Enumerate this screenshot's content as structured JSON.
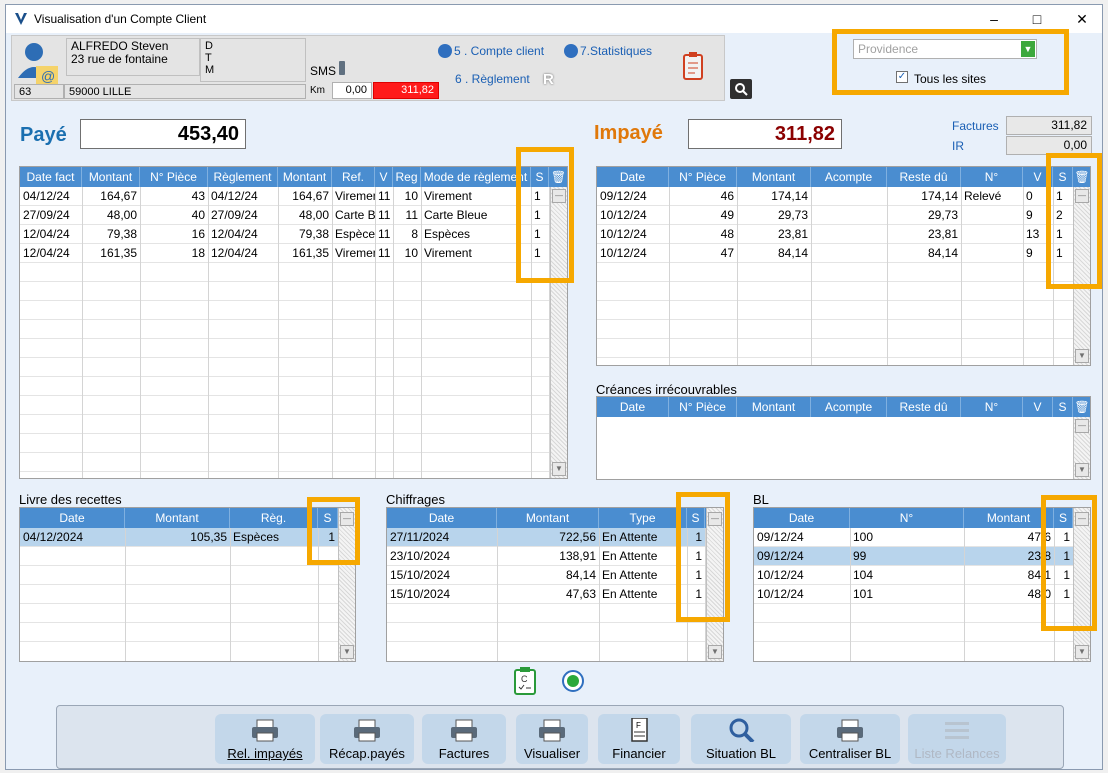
{
  "window": {
    "title": "Visualisation d'un Compte Client"
  },
  "client": {
    "name": "ALFREDO Steven",
    "address": "23 rue de fontaine",
    "flags": [
      "D",
      "T",
      "M"
    ],
    "code": "63",
    "city": "59000 LILLE",
    "sms": "SMS",
    "km_label": "Km",
    "km": "0,00",
    "balance": "311,82"
  },
  "links": {
    "compte": "5 . Compte client",
    "stats": "7.Statistiques",
    "reglement": "6 . Règlement",
    "r": "R"
  },
  "site": {
    "selected": "Providence",
    "all_sites": "Tous les sites"
  },
  "paye": {
    "label": "Payé",
    "value": "453,40"
  },
  "impaye": {
    "label": "Impayé",
    "value": "311,82"
  },
  "totals": {
    "factures_label": "Factures",
    "factures": "311,82",
    "ir_label": "IR",
    "ir": "0,00"
  },
  "paid": {
    "headers": [
      "Date fact",
      "Montant",
      "N° Pièce",
      "Règlement",
      "Montant",
      "Ref.",
      "V",
      "Reg",
      "Mode de règlement",
      "S"
    ],
    "rows": [
      [
        "04/12/24",
        "164,67",
        "43",
        "04/12/24",
        "164,67",
        "Virement",
        "11",
        "10",
        "Virement",
        "1"
      ],
      [
        "27/09/24",
        "48,00",
        "40",
        "27/09/24",
        "48,00",
        "Carte Bleue",
        "11",
        "11",
        "Carte Bleue",
        "1"
      ],
      [
        "12/04/24",
        "79,38",
        "16",
        "12/04/24",
        "79,38",
        "Espèces",
        "11",
        "8",
        "Espèces",
        "1"
      ],
      [
        "12/04/24",
        "161,35",
        "18",
        "12/04/24",
        "161,35",
        "Virement",
        "11",
        "10",
        "Virement",
        "1"
      ]
    ]
  },
  "unpaid": {
    "headers": [
      "Date",
      "N° Pièce",
      "Montant",
      "Acompte",
      "Reste dû",
      "N°",
      "V",
      "S"
    ],
    "rows": [
      [
        "09/12/24",
        "46",
        "174,14",
        "",
        "174,14",
        "Relevé",
        "0",
        "1"
      ],
      [
        "10/12/24",
        "49",
        "29,73",
        "",
        "29,73",
        "",
        "9",
        "2"
      ],
      [
        "10/12/24",
        "48",
        "23,81",
        "",
        "23,81",
        "",
        "13",
        "1"
      ],
      [
        "10/12/24",
        "47",
        "84,14",
        "",
        "84,14",
        "",
        "9",
        "1"
      ]
    ]
  },
  "creances": {
    "title": "Créances irrécouvrables",
    "headers": [
      "Date",
      "N° Pièce",
      "Montant",
      "Acompte",
      "Reste dû",
      "N°",
      "V",
      "S"
    ]
  },
  "livre": {
    "title": "Livre des recettes",
    "headers": [
      "Date",
      "Montant",
      "Règ.",
      "S"
    ],
    "rows": [
      [
        "04/12/2024",
        "105,35",
        "Espèces",
        "1"
      ]
    ]
  },
  "chiffrages": {
    "title": "Chiffrages",
    "headers": [
      "Date",
      "Montant",
      "Type",
      "S"
    ],
    "rows": [
      [
        "27/11/2024",
        "722,56",
        "En Attente",
        "1"
      ],
      [
        "23/10/2024",
        "138,91",
        "En Attente",
        "1"
      ],
      [
        "15/10/2024",
        "84,14",
        "En Attente",
        "1"
      ],
      [
        "15/10/2024",
        "47,63",
        "En Attente",
        "1"
      ]
    ]
  },
  "bl": {
    "title": "BL",
    "headers": [
      "Date",
      "N°",
      "Montant",
      "S"
    ],
    "rows": [
      [
        "09/12/24",
        "100",
        "47,6",
        "1"
      ],
      [
        "09/12/24",
        "99",
        "23,8",
        "1"
      ],
      [
        "10/12/24",
        "104",
        "84,1",
        "1"
      ],
      [
        "10/12/24",
        "101",
        "48,0",
        "1"
      ]
    ]
  },
  "buttons": [
    "Rel. impayés",
    "Récap.payés",
    "Factures",
    "Visualiser",
    "Financier",
    "Situation BL",
    "Centraliser BL",
    "Liste Relances"
  ],
  "colors": {
    "paye": "#1a6fb0",
    "impaye": "#e0780a",
    "impaye_value": "#8b0000",
    "balance_bg": "#ff1a1a",
    "highlight": "#f6a800",
    "header": "#4a8dd0"
  }
}
